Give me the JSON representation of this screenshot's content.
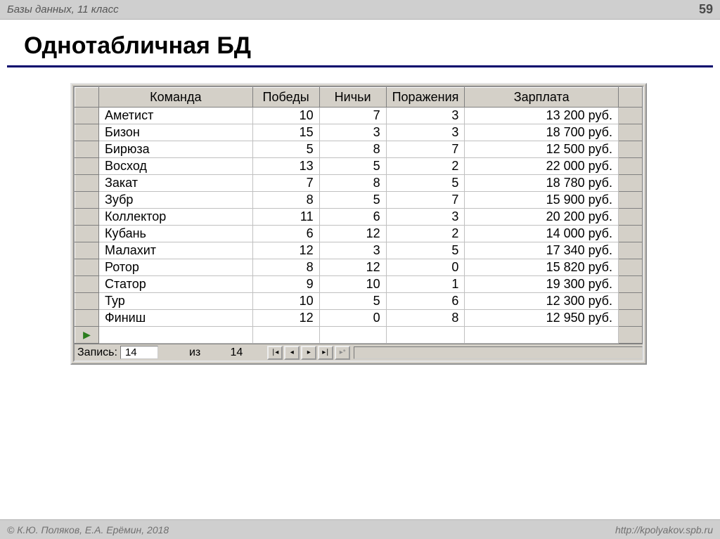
{
  "header": {
    "breadcrumb": "Базы данных, 11 класс",
    "page_number": "59"
  },
  "title": "Однотабличная БД",
  "table": {
    "columns": [
      "Команда",
      "Победы",
      "Ничьи",
      "Поражения",
      "Зарплата"
    ],
    "rows": [
      {
        "team": "Аметист",
        "wins": 10,
        "draws": 7,
        "losses": 3,
        "salary": "13 200 руб."
      },
      {
        "team": "Бизон",
        "wins": 15,
        "draws": 3,
        "losses": 3,
        "salary": "18 700 руб."
      },
      {
        "team": "Бирюза",
        "wins": 5,
        "draws": 8,
        "losses": 7,
        "salary": "12 500 руб."
      },
      {
        "team": "Восход",
        "wins": 13,
        "draws": 5,
        "losses": 2,
        "salary": "22 000 руб."
      },
      {
        "team": "Закат",
        "wins": 7,
        "draws": 8,
        "losses": 5,
        "salary": "18 780 руб."
      },
      {
        "team": "Зубр",
        "wins": 8,
        "draws": 5,
        "losses": 7,
        "salary": "15 900 руб."
      },
      {
        "team": "Коллектор",
        "wins": 11,
        "draws": 6,
        "losses": 3,
        "salary": "20 200 руб."
      },
      {
        "team": "Кубань",
        "wins": 6,
        "draws": 12,
        "losses": 2,
        "salary": "14 000 руб."
      },
      {
        "team": "Малахит",
        "wins": 12,
        "draws": 3,
        "losses": 5,
        "salary": "17 340 руб."
      },
      {
        "team": "Ротор",
        "wins": 8,
        "draws": 12,
        "losses": 0,
        "salary": "15 820 руб."
      },
      {
        "team": "Статор",
        "wins": 9,
        "draws": 10,
        "losses": 1,
        "salary": "19 300 руб."
      },
      {
        "team": "Тур",
        "wins": 10,
        "draws": 5,
        "losses": 6,
        "salary": "12 300 руб."
      },
      {
        "team": "Финиш",
        "wins": 12,
        "draws": 0,
        "losses": 8,
        "salary": "12 950 руб."
      }
    ]
  },
  "navigator": {
    "label_record": "Запись:",
    "current": "14",
    "label_of": "из",
    "total": "14"
  },
  "footer": {
    "copyright": "© К.Ю. Поляков, Е.А. Ерёмин, 2018",
    "url": "http://kpolyakov.spb.ru"
  }
}
